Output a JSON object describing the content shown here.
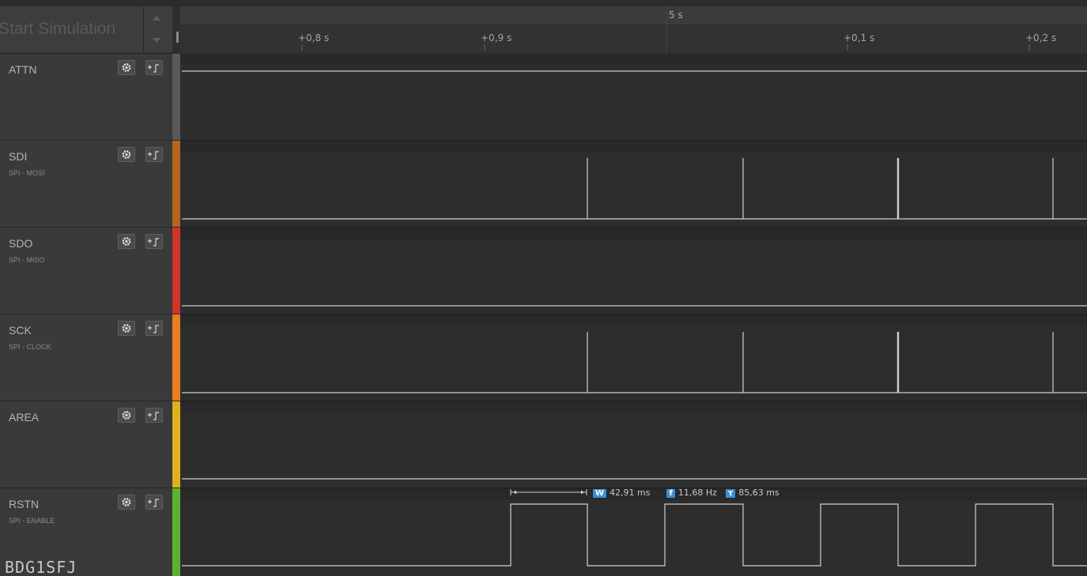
{
  "sidebar": {
    "simulation_label": "Start Simulation",
    "channels": [
      {
        "name": "ATTN",
        "sub": "",
        "color": "#595959"
      },
      {
        "name": "SDI",
        "sub": "SPI - MOSI",
        "color": "#b5651d"
      },
      {
        "name": "SDO",
        "sub": "SPI - MISO",
        "color": "#d0342c"
      },
      {
        "name": "SCK",
        "sub": "SPI - CLOCK",
        "color": "#e87f1e"
      },
      {
        "name": "AREA",
        "sub": "",
        "color": "#e0b020"
      },
      {
        "name": "RSTN",
        "sub": "SPI - ENABLE",
        "color": "#5cb031"
      }
    ],
    "watermark": "BDG1SFJ"
  },
  "ruler": {
    "major_label": "5 s",
    "ticks": [
      "+0,8 s",
      "+0,9 s",
      "+0,1 s",
      "+0,2 s"
    ]
  },
  "measurement": {
    "width_badge": "W",
    "width_value": "42,91 ms",
    "freq_badge": "f",
    "freq_value": "11,68 Hz",
    "period_badge": "τ",
    "period_value": "85,63 ms",
    "badge_color": "#3b8fd6"
  },
  "icons": {
    "settings": "gear-icon",
    "trigger": "trigger-edge-icon"
  }
}
